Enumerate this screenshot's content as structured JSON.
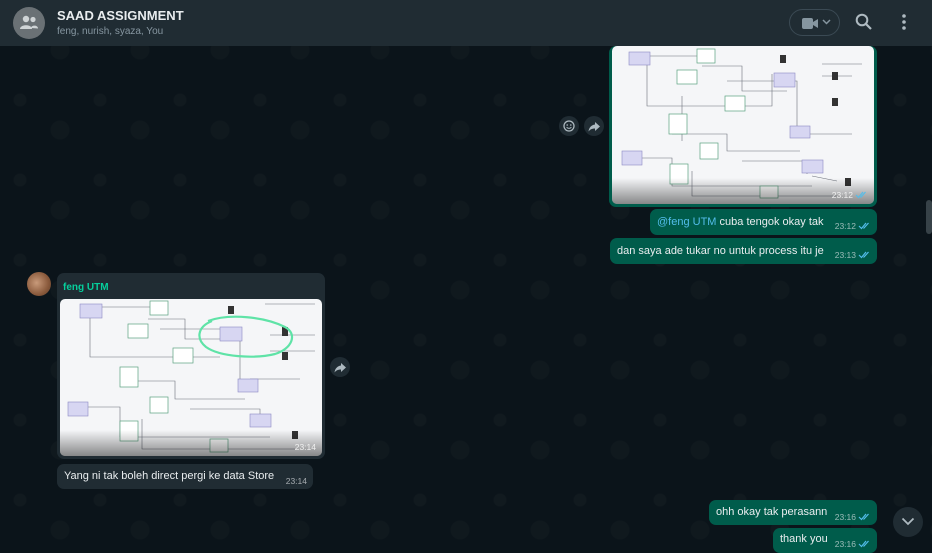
{
  "header": {
    "title": "SAAD ASSIGNMENT",
    "members": "feng, nurish, syaza, You"
  },
  "messages": [
    {
      "type": "image",
      "direction": "out",
      "time": "23:12",
      "status": "read"
    },
    {
      "type": "text",
      "direction": "out",
      "mention": "@feng UTM",
      "text": "cuba tengok okay tak",
      "time": "23:12",
      "status": "read"
    },
    {
      "type": "text",
      "direction": "out",
      "text": "dan saya ade tukar no untuk process itu je",
      "time": "23:13",
      "status": "read"
    },
    {
      "type": "image",
      "direction": "in",
      "sender": "feng UTM",
      "time": "23:14"
    },
    {
      "type": "text",
      "direction": "in",
      "text": "Yang ni tak boleh direct pergi ke data Store",
      "time": "23:14"
    },
    {
      "type": "text",
      "direction": "out",
      "text": "ohh okay tak perasann",
      "time": "23:16",
      "status": "read"
    },
    {
      "type": "text",
      "direction": "out",
      "text": "thank you",
      "time": "23:16",
      "status": "read"
    }
  ],
  "colors": {
    "chat_bg": "#0b141a",
    "header_bg": "#202c33",
    "outgoing_bubble": "#005c4b",
    "incoming_bubble": "#202c33",
    "sender_name": "#06cf9c",
    "mention": "#53bdeb",
    "read_ticks": "#53bdeb"
  },
  "icons": [
    "group-avatar-icon",
    "video-call-icon",
    "chevron-down-icon",
    "search-icon",
    "menu-icon",
    "emoji-icon",
    "forward-icon",
    "double-check-icon",
    "scroll-down-icon"
  ]
}
